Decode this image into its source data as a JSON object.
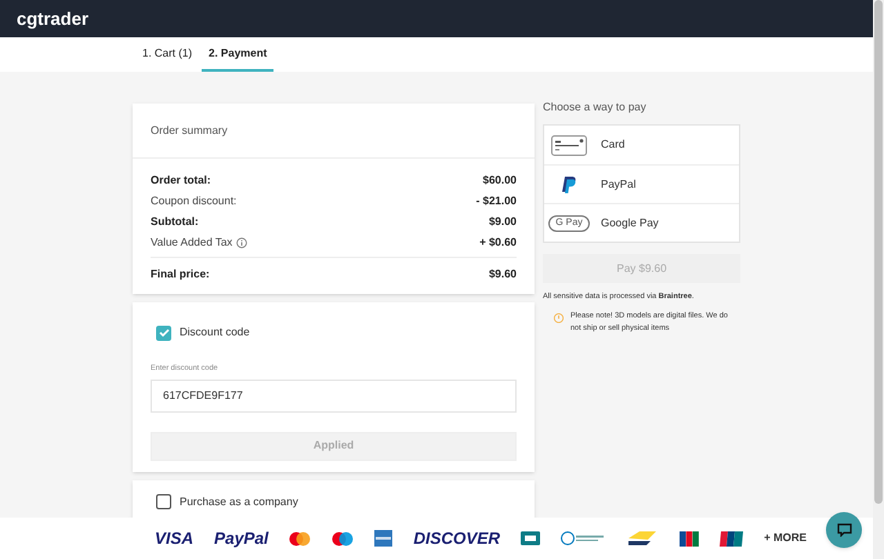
{
  "header": {
    "logo": "cgtrader"
  },
  "tabs": [
    {
      "label": "1. Cart (1)",
      "selected": false
    },
    {
      "label": "2. Payment",
      "selected": true
    }
  ],
  "order_summary": {
    "title": "Order summary",
    "rows": [
      {
        "label": "Order total:",
        "value": "$60.00",
        "bold": true,
        "info": false
      },
      {
        "label": "Coupon discount:",
        "value": "- $21.00",
        "bold": false,
        "info": false
      },
      {
        "label": "Subtotal:",
        "value": "$9.00",
        "bold": true,
        "info": false
      },
      {
        "label": "Value Added Tax",
        "value": "+ $0.60",
        "bold": false,
        "info": true
      }
    ],
    "final": {
      "label": "Final price:",
      "value": "$9.60"
    }
  },
  "discount": {
    "label": "Discount code",
    "checked": true,
    "field_label": "Enter discount code",
    "value": "617CFDE9F177",
    "button": "Applied"
  },
  "company": {
    "label": "Purchase as a company",
    "checked": false
  },
  "payment": {
    "title": "Choose a way to pay",
    "methods": [
      {
        "kind": "card",
        "label": "Card",
        "selected": false
      },
      {
        "kind": "paypal",
        "label": "PayPal",
        "selected": false
      },
      {
        "kind": "gpay",
        "label": "Google Pay",
        "selected": false,
        "badge": "G Pay"
      }
    ],
    "pay_button": "Pay $9.60",
    "secure_note": "All sensitive data is processed via **Braintree**.",
    "notice": "Please note! 3D models are digital files. We do not ship or sell physical items"
  },
  "brands": [
    {
      "kind": "text",
      "label": "VISA"
    },
    {
      "kind": "text",
      "label": "PayPal"
    },
    {
      "kind": "mastercard"
    },
    {
      "kind": "maestro"
    },
    {
      "kind": "amex"
    },
    {
      "kind": "text",
      "label": "DISCOVER"
    },
    {
      "kind": "cb"
    },
    {
      "kind": "diners"
    },
    {
      "kind": "bancontact"
    },
    {
      "kind": "jcb"
    },
    {
      "kind": "unionpay"
    },
    {
      "kind": "more",
      "label": "+ MORE"
    }
  ]
}
